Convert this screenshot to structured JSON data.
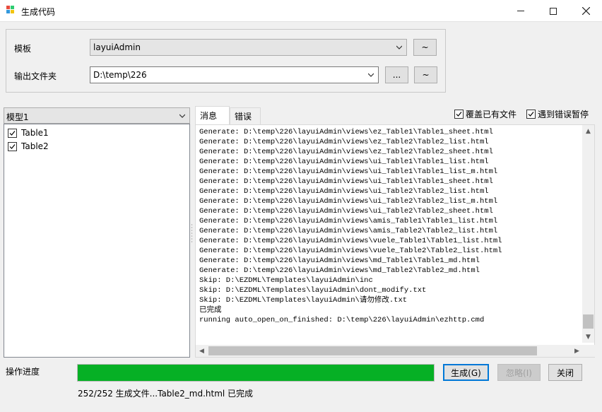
{
  "window": {
    "title": "生成代码",
    "icon": "app-blocks-icon",
    "minimize_icon": "minimize-icon",
    "maximize_icon": "maximize-icon",
    "close_icon": "close-icon"
  },
  "settings": {
    "template_label": "模板",
    "template_value": "layuiAdmin",
    "template_btn": "~",
    "output_label": "输出文件夹",
    "output_value": "D:\\temp\\226",
    "browse_btn": "...",
    "output_btn": "~"
  },
  "models": {
    "selected": "模型1",
    "tables": [
      {
        "label": "Table1",
        "checked": true
      },
      {
        "label": "Table2",
        "checked": true
      }
    ]
  },
  "tabs": [
    {
      "label": "消息",
      "active": true
    },
    {
      "label": "错误",
      "active": false
    }
  ],
  "options": {
    "overwrite_label": "覆盖已有文件",
    "overwrite_checked": true,
    "pause_on_error_label": "遇到错误暂停",
    "pause_on_error_checked": true
  },
  "messages": [
    "Generate: D:\\temp\\226\\layuiAdmin\\views\\ez_Table1\\Table1_sheet.html",
    "Generate: D:\\temp\\226\\layuiAdmin\\views\\ez_Table2\\Table2_list.html",
    "Generate: D:\\temp\\226\\layuiAdmin\\views\\ez_Table2\\Table2_sheet.html",
    "Generate: D:\\temp\\226\\layuiAdmin\\views\\ui_Table1\\Table1_list.html",
    "Generate: D:\\temp\\226\\layuiAdmin\\views\\ui_Table1\\Table1_list_m.html",
    "Generate: D:\\temp\\226\\layuiAdmin\\views\\ui_Table1\\Table1_sheet.html",
    "Generate: D:\\temp\\226\\layuiAdmin\\views\\ui_Table2\\Table2_list.html",
    "Generate: D:\\temp\\226\\layuiAdmin\\views\\ui_Table2\\Table2_list_m.html",
    "Generate: D:\\temp\\226\\layuiAdmin\\views\\ui_Table2\\Table2_sheet.html",
    "Generate: D:\\temp\\226\\layuiAdmin\\views\\amis_Table1\\Table1_list.html",
    "Generate: D:\\temp\\226\\layuiAdmin\\views\\amis_Table2\\Table2_list.html",
    "Generate: D:\\temp\\226\\layuiAdmin\\views\\vuele_Table1\\Table1_list.html",
    "Generate: D:\\temp\\226\\layuiAdmin\\views\\vuele_Table2\\Table2_list.html",
    "Generate: D:\\temp\\226\\layuiAdmin\\views\\md_Table1\\Table1_md.html",
    "Generate: D:\\temp\\226\\layuiAdmin\\views\\md_Table2\\Table2_md.html",
    "Skip: D:\\EZDML\\Templates\\layuiAdmin\\inc",
    "Skip: D:\\EZDML\\Templates\\layuiAdmin\\dont_modify.txt",
    "Skip: D:\\EZDML\\Templates\\layuiAdmin\\请勿修改.txt",
    "已完成",
    "running auto_open_on_finished: D:\\temp\\226\\layuiAdmin\\ezhttp.cmd"
  ],
  "progress": {
    "label": "操作进度",
    "fraction": 1.0,
    "status_text": "252/252 生成文件...Table2_md.html 已完成",
    "fill_color": "#06b025"
  },
  "actions": {
    "generate": "生成(G)",
    "ignore": "忽略(I)",
    "close": "关闭"
  }
}
